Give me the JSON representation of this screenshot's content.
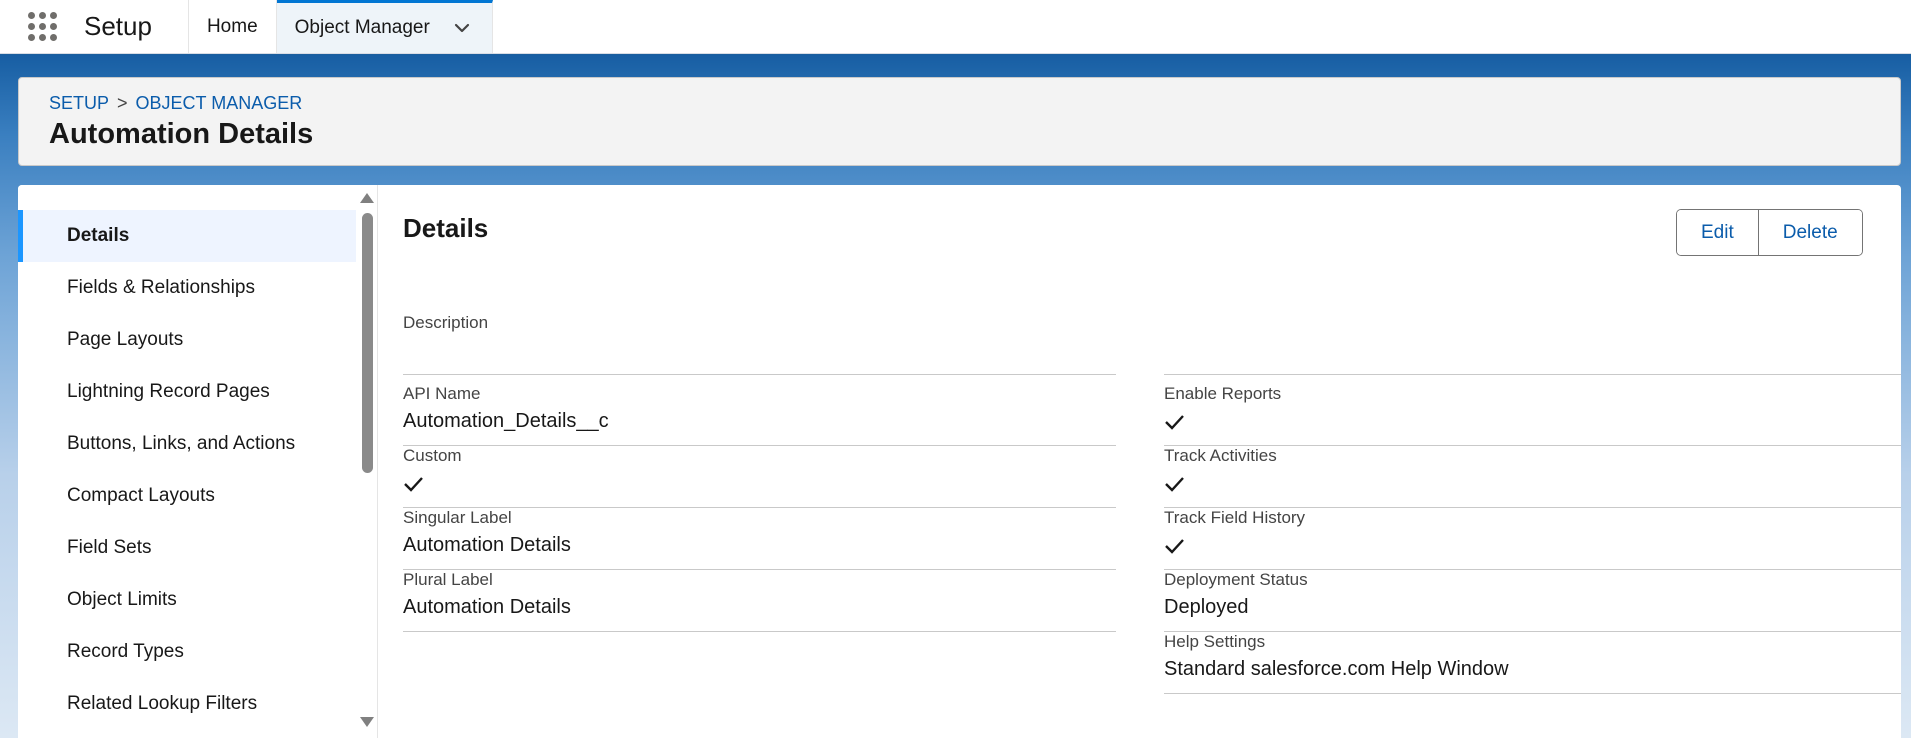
{
  "topnav": {
    "app_name": "Setup",
    "tabs": [
      {
        "label": "Home"
      },
      {
        "label": "Object Manager"
      }
    ]
  },
  "header": {
    "breadcrumb": [
      "SETUP",
      ">",
      "OBJECT MANAGER"
    ],
    "title": "Automation Details"
  },
  "sidebar": {
    "items": [
      {
        "label": "Details",
        "active": true
      },
      {
        "label": "Fields & Relationships"
      },
      {
        "label": "Page Layouts"
      },
      {
        "label": "Lightning Record Pages"
      },
      {
        "label": "Buttons, Links, and Actions"
      },
      {
        "label": "Compact Layouts"
      },
      {
        "label": "Field Sets"
      },
      {
        "label": "Object Limits"
      },
      {
        "label": "Record Types"
      },
      {
        "label": "Related Lookup Filters"
      }
    ]
  },
  "details": {
    "title": "Details",
    "edit_label": "Edit",
    "delete_label": "Delete",
    "fields": {
      "description": {
        "label": "Description",
        "value": ""
      },
      "api_name": {
        "label": "API Name",
        "value": "Automation_Details__c"
      },
      "custom": {
        "label": "Custom",
        "checked": true
      },
      "singular_label": {
        "label": "Singular Label",
        "value": "Automation Details"
      },
      "plural_label": {
        "label": "Plural Label",
        "value": "Automation Details"
      },
      "enable_reports": {
        "label": "Enable Reports",
        "checked": true
      },
      "track_activities": {
        "label": "Track Activities",
        "checked": true
      },
      "track_field_history": {
        "label": "Track Field History",
        "checked": true
      },
      "deployment_status": {
        "label": "Deployment Status",
        "value": "Deployed"
      },
      "help_settings": {
        "label": "Help Settings",
        "value": "Standard salesforce.com Help Window"
      }
    }
  },
  "icons": {
    "app_launcher": "waffle-grid-icon",
    "tab_dropdown": "chevron-down-icon",
    "checkmark": "check-icon"
  },
  "colors": {
    "link": "#0b5cab",
    "active_accent": "#1b96ff",
    "nav_active_border": "#0176d3"
  }
}
